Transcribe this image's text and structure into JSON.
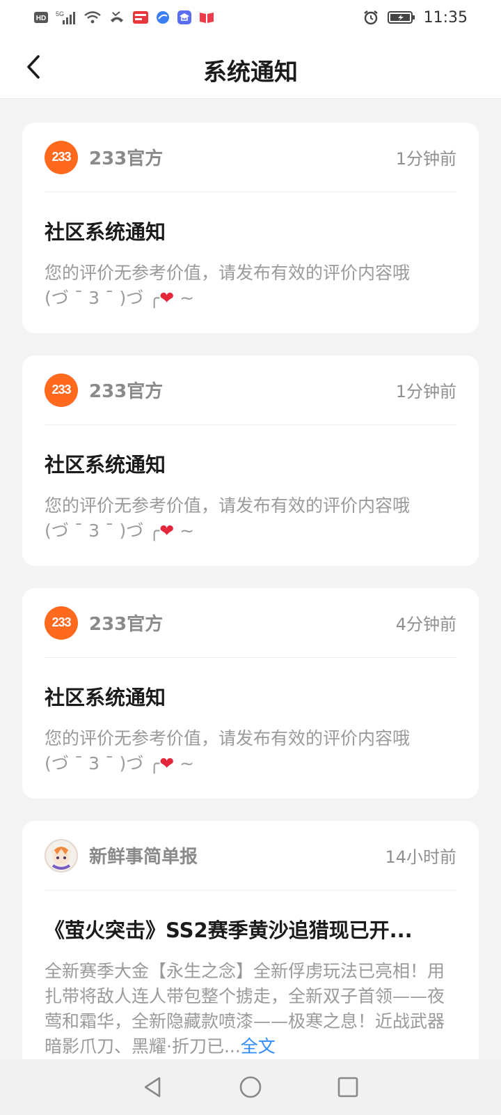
{
  "status_bar": {
    "left_icons": [
      "hd-icon",
      "signal-5g-icon",
      "wifi-icon",
      "missed-call-icon",
      "toutiao-app-icon",
      "browser-app-icon",
      "study-app-icon",
      "book-app-icon"
    ],
    "right_icons": [
      "alarm-icon",
      "battery-icon"
    ],
    "hd_label": "HD",
    "net_label": "5G",
    "time": "11:35"
  },
  "header": {
    "title": "系统通知"
  },
  "notifications": [
    {
      "avatar_text": "233",
      "sender": "233官方",
      "time": "1分钟前",
      "title": "社区系统通知",
      "text_line1": "您的评价无参考价值，请发布有效的评价内容哦",
      "text_line2_prefix": "(づ ¯ 3 ¯ )づ ╭",
      "heart": "❤",
      "text_line2_suffix": "~"
    },
    {
      "avatar_text": "233",
      "sender": "233官方",
      "time": "1分钟前",
      "title": "社区系统通知",
      "text_line1": "您的评价无参考价值，请发布有效的评价内容哦",
      "text_line2_prefix": "(づ ¯ 3 ¯ )づ ╭",
      "heart": "❤",
      "text_line2_suffix": "~"
    },
    {
      "avatar_text": "233",
      "sender": "233官方",
      "time": "4分钟前",
      "title": "社区系统通知",
      "text_line1": "您的评价无参考价值，请发布有效的评价内容哦",
      "text_line2_prefix": "(づ ¯ 3 ¯ )づ ╭",
      "heart": "❤",
      "text_line2_suffix": "~"
    },
    {
      "sender": "新鲜事简单报",
      "time": "14小时前",
      "title": "《萤火突击》SS2赛季黄沙追猎现已开...",
      "body": "全新赛季大金【永生之念】全新俘虏玩法已亮相！用扎带将敌人连人带包整个掳走，全新双子首领——夜莺和霜华，全新隐藏款喷漆——极寒之息！近战武器暗影爪刀、黑耀·折刀已...",
      "more": "全文"
    }
  ],
  "nav_bar": {
    "icons": [
      "back-triangle-icon",
      "home-circle-icon",
      "recents-square-icon"
    ]
  },
  "colors": {
    "accent_orange": "#ff6a1f",
    "link_blue": "#2f8cff",
    "heart_red": "#e3263a",
    "background": "#f4f4f4"
  }
}
